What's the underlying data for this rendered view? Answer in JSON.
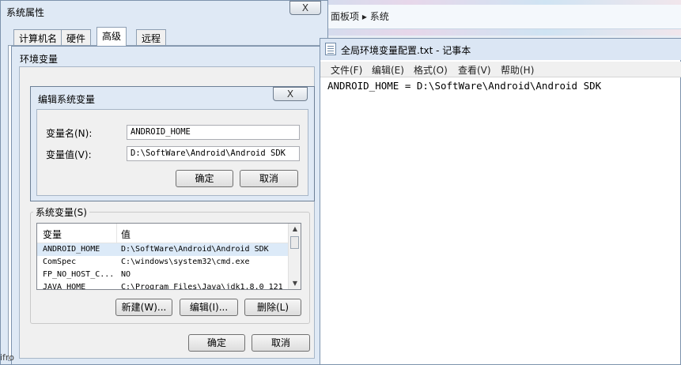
{
  "background": {
    "breadcrumb": [
      "面板项",
      "系统"
    ]
  },
  "system_properties": {
    "title": "系统属性",
    "close_label": "X",
    "tabs": [
      {
        "label": "计算机名",
        "active": false
      },
      {
        "label": "硬件",
        "active": false
      },
      {
        "label": "高级",
        "active": true
      },
      {
        "label": "远程",
        "active": false
      }
    ]
  },
  "env_dialog": {
    "title": "环境变量",
    "system_vars_label": "系统变量(S)",
    "columns": [
      "变量",
      "值"
    ],
    "rows": [
      {
        "name": "ANDROID_HOME",
        "value": "D:\\SoftWare\\Android\\Android SDK",
        "selected": true
      },
      {
        "name": "ComSpec",
        "value": "C:\\windows\\system32\\cmd.exe",
        "selected": false
      },
      {
        "name": "FP_NO_HOST_C...",
        "value": "NO",
        "selected": false
      },
      {
        "name": "JAVA_HOME",
        "value": "C:\\Program Files\\Java\\jdk1.8.0_121",
        "selected": false
      }
    ],
    "new_button": "新建(W)...",
    "edit_button": "编辑(I)...",
    "delete_button": "删除(L)",
    "ok_button": "确定",
    "cancel_button": "取消"
  },
  "edit_dialog": {
    "title": "编辑系统变量",
    "name_label": "变量名(N):",
    "name_value": "ANDROID_HOME",
    "value_label": "变量值(V):",
    "value_value": "D:\\SoftWare\\Android\\Android SDK",
    "ok_button": "确定",
    "cancel_button": "取消",
    "close_label": "X"
  },
  "notepad": {
    "title": "全局环境变量配置.txt - 记事本",
    "menus": [
      "文件(F)",
      "编辑(E)",
      "格式(O)",
      "查看(V)",
      "帮助(H)"
    ],
    "content": "ANDROID_HOME = D:\\SoftWare\\Android\\Android SDK"
  },
  "side_text": "ifro"
}
